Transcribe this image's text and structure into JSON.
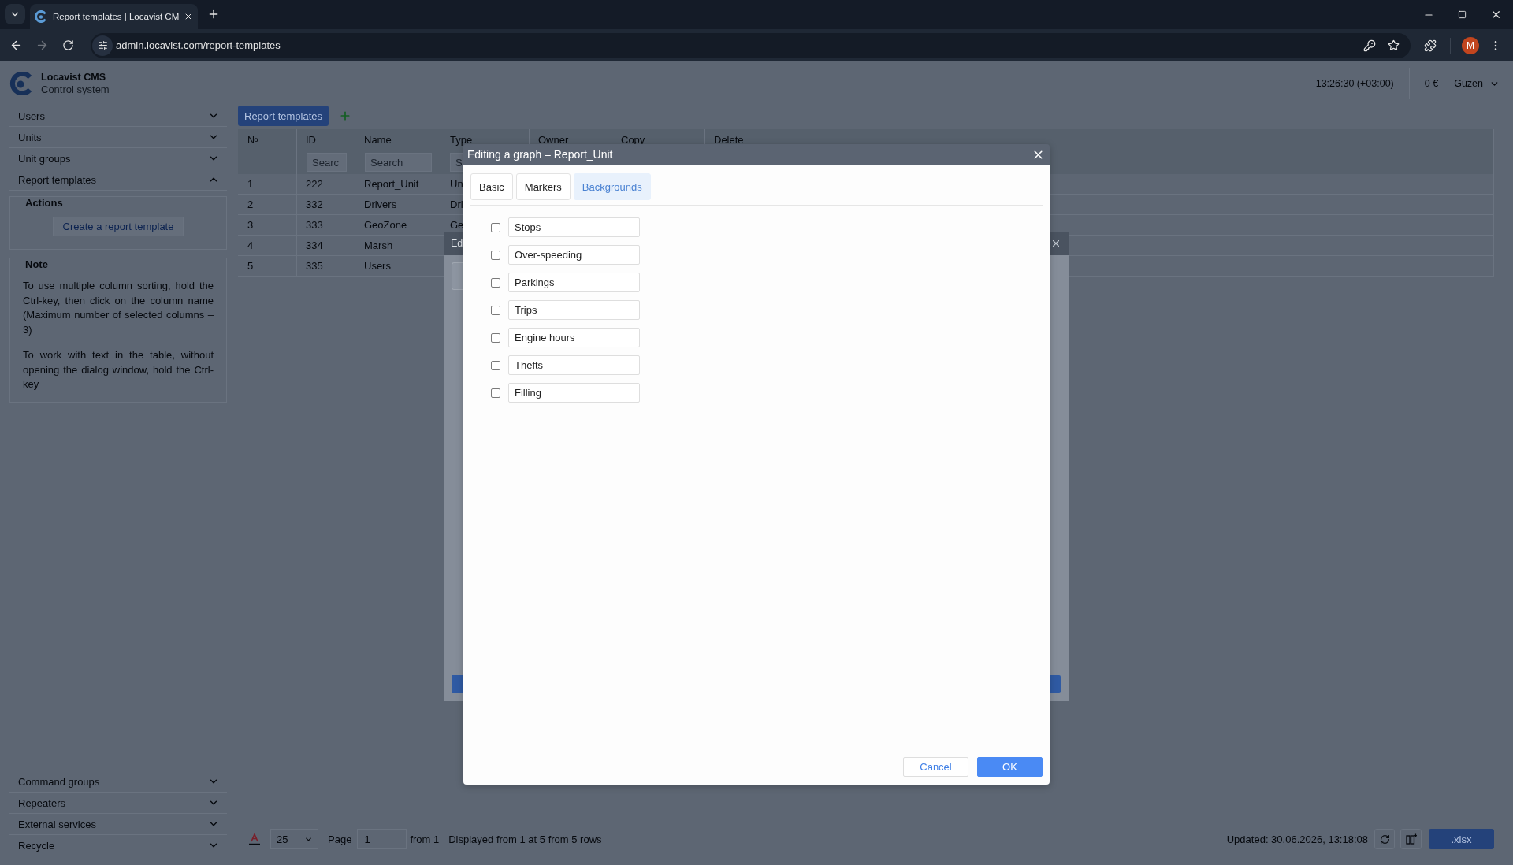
{
  "browser": {
    "tab_title": "Report templates | Locavist CM",
    "url": "admin.locavist.com/report-templates",
    "profile_initial": "M"
  },
  "app_header": {
    "brand": "Locavist CMS",
    "subtitle": "Control system",
    "clock": "13:26:30 (+03:00)",
    "balance": "0 €",
    "user": "Guzen"
  },
  "sidebar": {
    "sections": [
      {
        "label": "Users",
        "expanded": false
      },
      {
        "label": "Units",
        "expanded": false
      },
      {
        "label": "Unit groups",
        "expanded": false
      },
      {
        "label": "Report templates",
        "expanded": true
      }
    ],
    "actions": {
      "title": "Actions",
      "link": "Create a report template"
    },
    "note": {
      "title": "Note",
      "paragraphs": [
        "To use multiple column sorting, hold the Ctrl-key, then click on the column name (Maximum number of selected columns – 3)",
        "To work with text in the table, without opening the dialog window, hold the Ctrl-key"
      ]
    },
    "bottom_sections": [
      {
        "label": "Command groups",
        "expanded": false
      },
      {
        "label": "Repeaters",
        "expanded": false
      },
      {
        "label": "External services",
        "expanded": false
      },
      {
        "label": "Recycle",
        "expanded": false
      }
    ]
  },
  "main": {
    "tabs": [
      {
        "label": "Report templates",
        "selected": true
      }
    ],
    "table": {
      "columns": [
        "№",
        "ID",
        "Name",
        "Type",
        "Owner",
        "Copy",
        "Delete"
      ],
      "search_row": [
        {
          "kind": "blank"
        },
        {
          "kind": "field",
          "placeholder": "Searc"
        },
        {
          "kind": "field",
          "placeholder": "Search"
        },
        {
          "kind": "field",
          "placeholder": "S"
        }
      ],
      "rows": [
        {
          "cells": [
            "1",
            "222",
            "Report_Unit",
            "Un"
          ]
        },
        {
          "cells": [
            "2",
            "332",
            "Drivers",
            "Dri"
          ]
        },
        {
          "cells": [
            "3",
            "333",
            "GeoZone",
            "Ge"
          ]
        },
        {
          "cells": [
            "4",
            "334",
            "Marsh"
          ]
        },
        {
          "cells": [
            "5",
            "335",
            "Users"
          ]
        }
      ]
    },
    "footer": {
      "page_size": "25",
      "page_label": "Page",
      "page": "1",
      "page_total": "from 1",
      "summary": "Displayed from 1 at 5 from 5 rows",
      "updated": "Updated: 30.06.2026, 13:18:08",
      "export": ".xlsx"
    }
  },
  "back_dialog": {
    "title": "Ed"
  },
  "dialog": {
    "title": "Editing a graph – Report_Unit",
    "tabs": [
      {
        "label": "Basic",
        "selected": false
      },
      {
        "label": "Markers",
        "selected": false
      },
      {
        "label": "Backgrounds",
        "selected": true
      }
    ],
    "items": [
      {
        "label": "Stops",
        "checked": false
      },
      {
        "label": "Over-speeding",
        "checked": false
      },
      {
        "label": "Parkings",
        "checked": false
      },
      {
        "label": "Trips",
        "checked": false
      },
      {
        "label": "Engine hours",
        "checked": false
      },
      {
        "label": "Thefts",
        "checked": false
      },
      {
        "label": "Filling",
        "checked": false
      }
    ],
    "buttons": [
      {
        "label": "Cancel",
        "kind": "secondary"
      },
      {
        "label": "OK",
        "kind": "primary"
      }
    ]
  }
}
